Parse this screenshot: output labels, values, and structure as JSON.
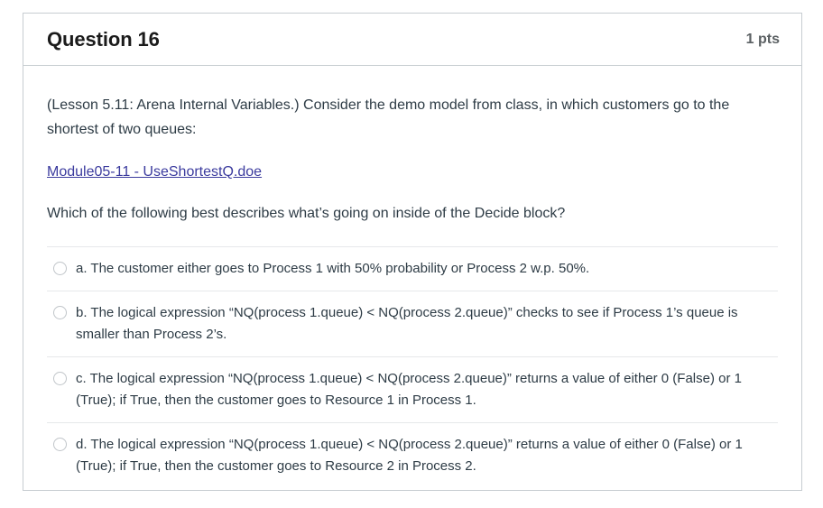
{
  "header": {
    "title": "Question 16",
    "points": "1 pts"
  },
  "body": {
    "intro": "(Lesson 5.11: Arena Internal Variables.) Consider the demo model from class, in which customers go to the shortest of two queues:",
    "link_label": "Module05-11 - UseShortestQ.doe",
    "prompt": "Which of the following best describes what’s going on inside of the Decide block?"
  },
  "answers": [
    {
      "id": "a",
      "text": "a. The customer either goes to Process 1 with 50% probability or Process 2 w.p. 50%.",
      "selected": false
    },
    {
      "id": "b",
      "text": "b. The logical expression “NQ(process 1.queue) < NQ(process 2.queue)” checks to see if Process 1’s queue is smaller than Process 2’s.",
      "selected": false
    },
    {
      "id": "c",
      "text": "c. The logical expression “NQ(process 1.queue) < NQ(process 2.queue)” returns a value of either 0 (False) or 1 (True); if True, then the customer goes to Resource 1 in Process 1.",
      "selected": false
    },
    {
      "id": "d",
      "text": "d. The logical expression “NQ(process 1.queue) < NQ(process 2.queue)” returns a value of either 0 (False) or 1 (True); if True, then the customer goes to Resource 2 in Process 2.",
      "selected": false
    }
  ],
  "colors": {
    "text": "#2d3b45",
    "link": "#3b3b9e",
    "border": "#c7cdd1",
    "divider": "#e6e8ea",
    "points": "#5b6063"
  }
}
